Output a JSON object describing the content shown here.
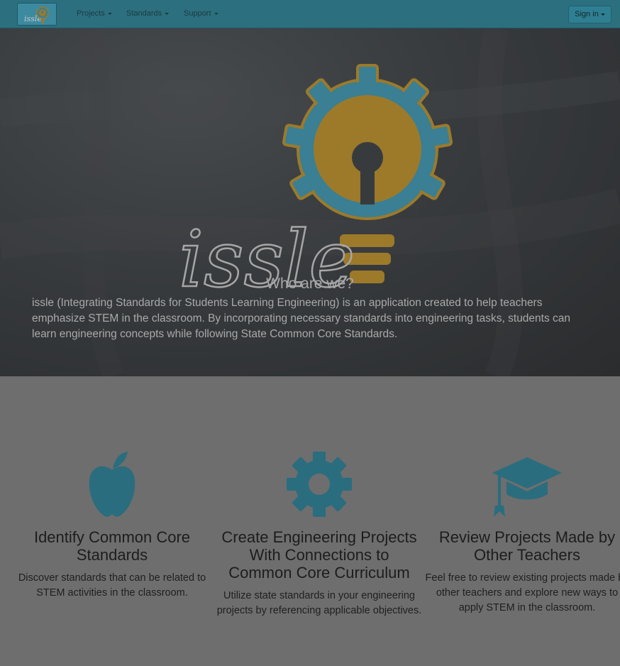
{
  "nav": {
    "brand_text": "issle",
    "items": [
      {
        "label": "Projects"
      },
      {
        "label": "Standards"
      },
      {
        "label": "Support"
      }
    ],
    "signin_label": "Sign in"
  },
  "hero": {
    "logo_text": "issle",
    "title": "Who are we?",
    "body": "issle (Integrating Standards for Students Learning Engineering) is an application created to help teachers emphasize STEM in the classroom. By incorporating necessary standards into engineering tasks, students can learn engineering concepts while following State Common Core Standards."
  },
  "features": [
    {
      "icon": "apple-icon",
      "title": "Identify Common Core Standards",
      "text": "Discover standards that can be related to STEM activities in the classroom."
    },
    {
      "icon": "gear-icon",
      "title": "Create Engineering Projects With Connections to Common Core Curriculum",
      "text": "Utilize state standards in your engineering projects by referencing applicable objectives."
    },
    {
      "icon": "graduation-cap-icon",
      "title": "Review Projects Made by Other Teachers",
      "text": "Feel free to review existing projects made by other teachers and explore new ways to apply STEM in the classroom."
    }
  ],
  "colors": {
    "navbar": "#2c6f7f",
    "icon_teal": "#2a6d7e",
    "logo_gold": "#9c7a2a",
    "logo_blue": "#3a7f93",
    "page_bg": "#6e6e6e"
  }
}
